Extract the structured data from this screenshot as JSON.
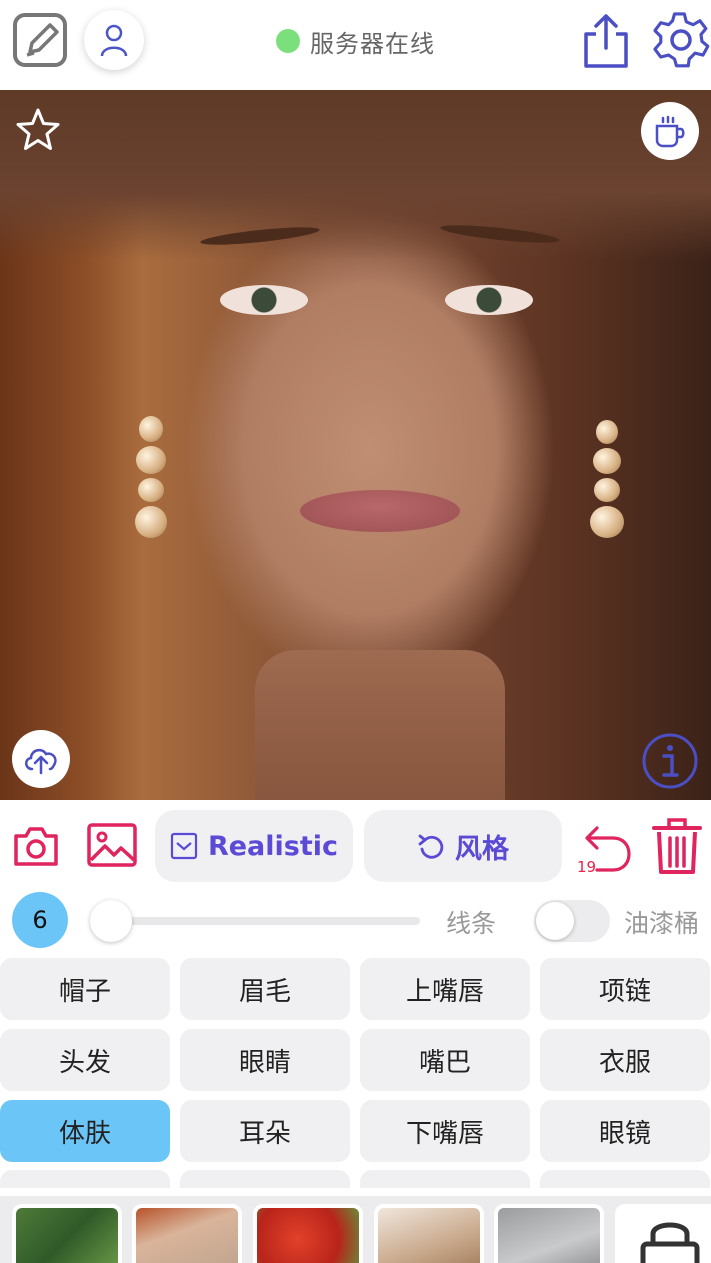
{
  "header": {
    "status_text": "服务器在线",
    "status_color": "#7be07b"
  },
  "icons": {
    "edit": "pencil-square-icon",
    "user": "user-icon",
    "share": "share-icon",
    "settings": "gear-icon",
    "favorite": "star-icon",
    "coffee": "coffee-cup-icon",
    "upload": "cloud-upload-icon",
    "info": "info-icon",
    "camera": "camera-icon",
    "gallery": "image-icon",
    "checkbox": "checkbox-icon",
    "refresh": "rotate-icon",
    "undo": "undo-icon",
    "trash": "trash-icon",
    "lock": "lock-icon"
  },
  "toolbar": {
    "model_label": "Realistic",
    "style_label": "风格",
    "undo_count": "19"
  },
  "brush": {
    "size": "6",
    "slider_level": 0.0,
    "mode_line_label": "线条",
    "mode_fill_label": "油漆桶",
    "fill_toggle_on": false
  },
  "parts": {
    "items": [
      {
        "label": "帽子",
        "active": false
      },
      {
        "label": "眉毛",
        "active": false
      },
      {
        "label": "上嘴唇",
        "active": false
      },
      {
        "label": "项链",
        "active": false
      },
      {
        "label": "头发",
        "active": false
      },
      {
        "label": "眼睛",
        "active": false
      },
      {
        "label": "嘴巴",
        "active": false
      },
      {
        "label": "衣服",
        "active": false
      },
      {
        "label": "体肤",
        "active": true
      },
      {
        "label": "耳朵",
        "active": false
      },
      {
        "label": "下嘴唇",
        "active": false
      },
      {
        "label": "眼镜",
        "active": false
      }
    ]
  },
  "colors": {
    "accent": "#5a4ad6",
    "danger": "#e0245e",
    "selected": "#6cc5f7"
  }
}
